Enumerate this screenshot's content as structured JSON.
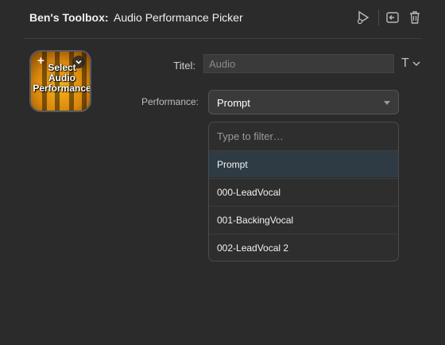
{
  "header": {
    "app_name": "Ben's Toolbox:",
    "title": "Audio Performance Picker",
    "icons": [
      "play-test-icon",
      "back-icon",
      "trash-icon"
    ]
  },
  "action_key": {
    "label": "Select\nAudio\nPerformance",
    "add_symbol": "+",
    "colors": {
      "center": "#f7b318",
      "edge": "#7a4206"
    }
  },
  "form": {
    "title_label": "Titel:",
    "title_value": "Audio",
    "title_style_symbol": "T",
    "performance_label": "Performance:",
    "performance_selected": "Prompt"
  },
  "dropdown": {
    "filter_placeholder": "Type to filter…",
    "options": [
      "Prompt",
      "000-LeadVocal",
      "001-BackingVocal",
      "002-LeadVocal 2"
    ],
    "selected_index": 0
  },
  "colors": {
    "background": "#2b2b2b",
    "selected_row": "#2f3b44"
  }
}
